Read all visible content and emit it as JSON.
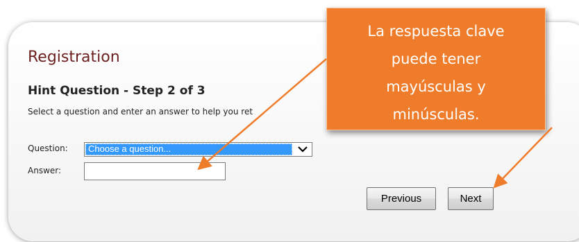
{
  "form": {
    "title": "Registration",
    "step_heading": "Hint Question - Step 2 of 3",
    "instructions": "Select a question and enter an answer to help you ret",
    "question_label": "Question:",
    "question_selected": "Choose a question...",
    "answer_label": "Answer:",
    "answer_value": "",
    "previous_label": "Previous",
    "next_label": "Next"
  },
  "callout": {
    "lines": [
      "La respuesta clave",
      "puede tener",
      "mayúsculas y",
      "minúsculas."
    ],
    "color": "#ee7c2b"
  },
  "icons": {
    "dropdown": "chevron-down-icon",
    "pointer": "arrow-icon"
  },
  "colors": {
    "title": "#6b1f1f",
    "selection": "#3399ff",
    "callout": "#ee7c2b"
  }
}
